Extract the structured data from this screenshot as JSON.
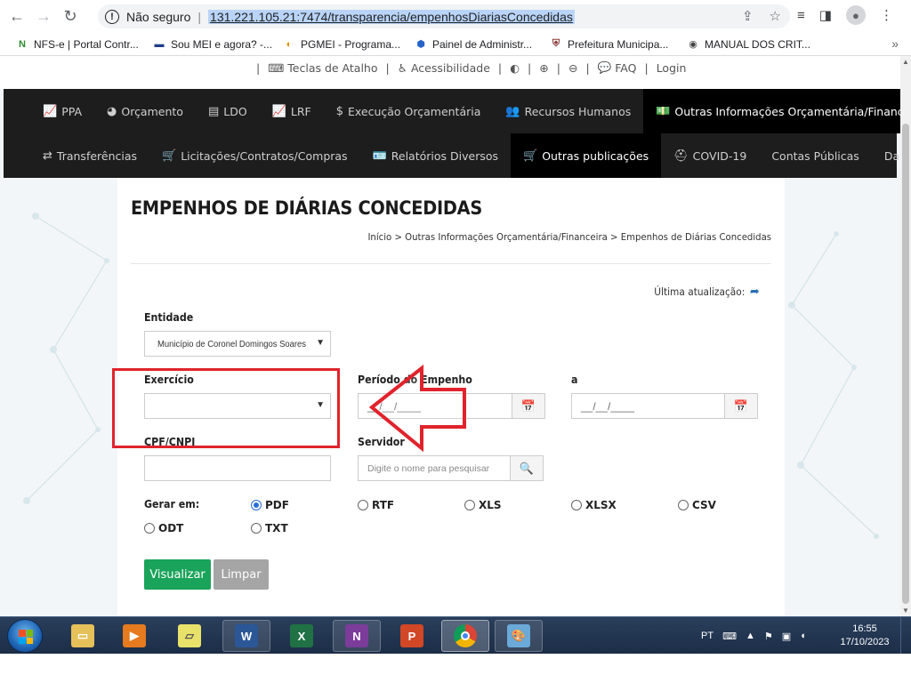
{
  "browser": {
    "security_label": "Não seguro",
    "url": "131.221.105.21:7474/transparencia/empenhosDiariasConcedidas",
    "bookmarks": [
      {
        "label": "NFS-e | Portal Contr..."
      },
      {
        "label": "Sou MEI e agora? -..."
      },
      {
        "label": "PGMEI - Programa..."
      },
      {
        "label": "Painel de Administr..."
      },
      {
        "label": "Prefeitura Municipa..."
      },
      {
        "label": "MANUAL DOS CRIT..."
      }
    ],
    "more_bookmarks": "»"
  },
  "util_bar": {
    "items": [
      {
        "label": "Teclas de Atalho",
        "icon": "keyboard-icon"
      },
      {
        "label": "Acessibilidade",
        "icon": "accessibility-icon"
      },
      {
        "label": "",
        "icon": "contrast-icon"
      },
      {
        "label": "",
        "icon": "zoom-in-icon"
      },
      {
        "label": "",
        "icon": "zoom-out-icon"
      },
      {
        "label": "FAQ",
        "icon": "chat-icon"
      },
      {
        "label": "Login",
        "icon": ""
      }
    ]
  },
  "nav": {
    "row1": [
      {
        "label": "PPA",
        "icon": "chart-icon"
      },
      {
        "label": "Orçamento",
        "icon": "pie-icon"
      },
      {
        "label": "LDO",
        "icon": "doc-icon"
      },
      {
        "label": "LRF",
        "icon": "chart-icon"
      },
      {
        "label": "Execução Orçamentária",
        "icon": "dollar-icon"
      },
      {
        "label": "Recursos Humanos",
        "icon": "users-icon"
      },
      {
        "label": "Outras Informações Orçamentária/Financeira",
        "icon": "money-icon"
      }
    ],
    "row2": [
      {
        "label": "Transferências",
        "icon": "exchange-icon"
      },
      {
        "label": "Licitações/Contratos/Compras",
        "icon": "cart-icon"
      },
      {
        "label": "Relatórios Diversos",
        "icon": "id-card-icon"
      },
      {
        "label": "Outras publicações",
        "icon": "cart-icon"
      },
      {
        "label": "COVID-19",
        "icon": "medkit-icon"
      },
      {
        "label": "Contas Públicas",
        "icon": ""
      },
      {
        "label": "Dados abertos",
        "icon": ""
      }
    ]
  },
  "page": {
    "title": "EMPENHOS DE DIÁRIAS CONCEDIDAS",
    "breadcrumb": "Início > Outras Informações Orçamentária/Financeira > Empenhos de Diárias Concedidas",
    "last_update_label": "Última atualização:"
  },
  "form": {
    "entidade_label": "Entidade",
    "entidade_value": "Município de Coronel Domingos Soares",
    "exercicio_label": "Exercício",
    "exercicio_value": "",
    "periodo_label": "Período do Empenho",
    "periodo_from": "__/__/____",
    "a_label": "a",
    "periodo_to": "__/__/____",
    "cpf_label": "CPF/CNPJ",
    "cpf_value": "",
    "servidor_label": "Servidor",
    "servidor_placeholder": "Digite o nome para pesquisar",
    "gerar_label": "Gerar em:",
    "formats": [
      "PDF",
      "RTF",
      "XLS",
      "XLSX",
      "CSV",
      "ODT",
      "TXT"
    ],
    "selected_format": "PDF",
    "visualizar_label": "Visualizar",
    "limpar_label": "Limpar"
  },
  "taskbar": {
    "apps": [
      {
        "name": "explorer",
        "icon": "folder-icon"
      },
      {
        "name": "media-player",
        "icon": "media-icon"
      },
      {
        "name": "sticky-notes",
        "icon": "notes-icon"
      },
      {
        "name": "word",
        "icon": "word-icon"
      },
      {
        "name": "excel",
        "icon": "excel-icon"
      },
      {
        "name": "onenote",
        "icon": "onenote-icon"
      },
      {
        "name": "powerpoint",
        "icon": "powerpoint-icon"
      },
      {
        "name": "chrome",
        "icon": "chrome-icon"
      },
      {
        "name": "paint",
        "icon": "paint-icon"
      }
    ],
    "language": "PT",
    "time": "16:55",
    "date": "17/10/2023"
  },
  "colors": {
    "nav_bg": "#1d1d1d",
    "accent_green": "#1aa35a",
    "annotation_red": "#e0232c",
    "link_blue": "#2a6fb5"
  }
}
